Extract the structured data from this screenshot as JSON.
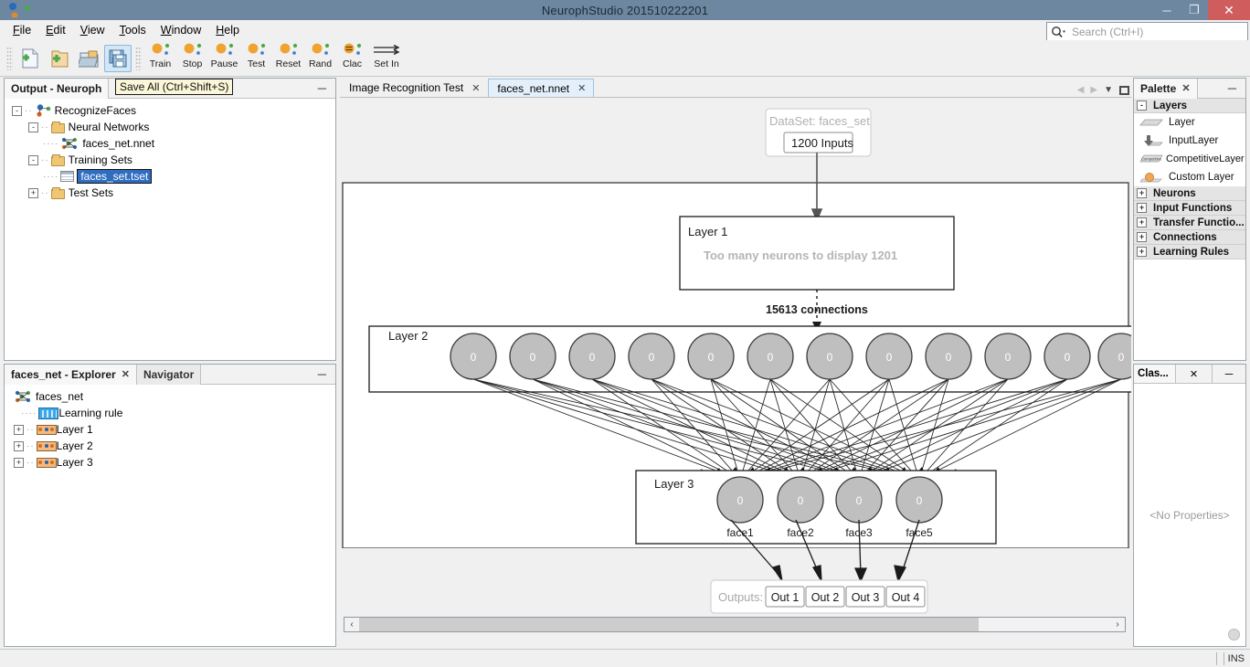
{
  "window": {
    "title": "NeurophStudio 201510222201",
    "minimize_label": "─",
    "maximize_label": "❐",
    "close_label": "✕"
  },
  "menubar": {
    "items": [
      {
        "label": "File",
        "accel": "F"
      },
      {
        "label": "Edit",
        "accel": "E"
      },
      {
        "label": "View",
        "accel": "V"
      },
      {
        "label": "Tools",
        "accel": "T"
      },
      {
        "label": "Window",
        "accel": "W"
      },
      {
        "label": "Help",
        "accel": "H"
      }
    ]
  },
  "search": {
    "placeholder": "Search (Ctrl+I)",
    "icon": "magnifier-icon"
  },
  "toolbar": {
    "file_buttons": [
      {
        "name": "new-file-button",
        "icon": "new-file-icon"
      },
      {
        "name": "new-project-button",
        "icon": "new-project-icon"
      },
      {
        "name": "open-project-button",
        "icon": "open-folder-icon"
      },
      {
        "name": "save-all-button",
        "icon": "save-all-icon",
        "selected": true
      }
    ],
    "actions": [
      {
        "label": "Train",
        "icon": "neuron-icon"
      },
      {
        "label": "Stop",
        "icon": "neuron-icon"
      },
      {
        "label": "Pause",
        "icon": "neuron-icon"
      },
      {
        "label": "Test",
        "icon": "neuron-icon"
      },
      {
        "label": "Reset",
        "icon": "neuron-icon"
      },
      {
        "label": "Rand",
        "icon": "neuron-icon"
      },
      {
        "label": "Clac",
        "icon": "neuron-calc-icon"
      },
      {
        "label": "Set In",
        "icon": "arrows-right-icon"
      }
    ]
  },
  "tooltip": {
    "save_all": "Save All (Ctrl+Shift+S)"
  },
  "output_panel": {
    "title": "Output - Neuroph",
    "minimize_label": "─",
    "tree": [
      {
        "label": "RecognizeFaces",
        "depth": 0,
        "toggle": "-",
        "icon": "project-icon",
        "selected": false
      },
      {
        "label": "Neural Networks",
        "depth": 1,
        "toggle": "-",
        "icon": "folder-icon",
        "selected": false
      },
      {
        "label": "faces_net.nnet",
        "depth": 2,
        "toggle": "",
        "icon": "network-icon",
        "selected": false
      },
      {
        "label": "Training Sets",
        "depth": 1,
        "toggle": "-",
        "icon": "folder-icon",
        "selected": false
      },
      {
        "label": "faces_set.tset",
        "depth": 2,
        "toggle": "",
        "icon": "table-icon",
        "selected": true
      },
      {
        "label": "Test Sets",
        "depth": 1,
        "toggle": "+",
        "icon": "folder-icon",
        "selected": false
      }
    ]
  },
  "explorer_panel": {
    "tabs": [
      {
        "label": "faces_net - Explorer",
        "active": true,
        "closable": true
      },
      {
        "label": "Navigator",
        "active": false,
        "closable": false
      }
    ],
    "minimize_label": "─",
    "tree": [
      {
        "label": "faces_net",
        "depth": 0,
        "toggle": "",
        "icon": "network-icon"
      },
      {
        "label": "Learning rule",
        "depth": 1,
        "toggle": "",
        "icon": "learning-rule-icon"
      },
      {
        "label": "Layer 1",
        "depth": 1,
        "toggle": "+",
        "icon": "layer-icon"
      },
      {
        "label": "Layer 2",
        "depth": 1,
        "toggle": "+",
        "icon": "layer-icon"
      },
      {
        "label": "Layer 3",
        "depth": 1,
        "toggle": "+",
        "icon": "layer-icon"
      }
    ]
  },
  "editor": {
    "tabs": [
      {
        "label": "Image Recognition Test",
        "active": false
      },
      {
        "label": "faces_net.nnet",
        "active": true
      }
    ],
    "nav": {
      "prev": "◀",
      "next": "▶",
      "dropdown": "▼",
      "maximize": "maximize-icon"
    },
    "scrollbar": {
      "left_arrow": "‹",
      "right_arrow": "›"
    }
  },
  "diagram": {
    "dataset": {
      "title": "DataSet: faces_set",
      "inputs_label": "1200 Inputs"
    },
    "layer1": {
      "title": "Layer 1",
      "note": "Too many neurons to display 1201"
    },
    "connections_label": "15613 connections",
    "layer2": {
      "title": "Layer 2",
      "neuron_value": "0",
      "visible_neurons": 13
    },
    "layer3": {
      "title": "Layer 3",
      "neuron_value": "0",
      "neuron_labels": [
        "face1",
        "face2",
        "face3",
        "face5"
      ]
    },
    "outputs": {
      "label": "Outputs:",
      "items": [
        "Out 1",
        "Out 2",
        "Out 3",
        "Out 4"
      ]
    }
  },
  "palette_panel": {
    "title": "Palette",
    "close_label": "✕",
    "minimize_label": "─",
    "groups": [
      {
        "label": "Layers",
        "toggle": "-",
        "expanded": true,
        "items": [
          {
            "label": "Layer",
            "icon": "layer-shape-icon"
          },
          {
            "label": "InputLayer",
            "icon": "input-layer-icon"
          },
          {
            "label": "CompetitiveLayer",
            "icon": "competitive-layer-icon"
          },
          {
            "label": "Custom Layer",
            "icon": "custom-layer-icon"
          }
        ]
      },
      {
        "label": "Neurons",
        "toggle": "+",
        "expanded": false,
        "items": []
      },
      {
        "label": "Input Functions",
        "toggle": "+",
        "expanded": false,
        "items": []
      },
      {
        "label": "Transfer Functio...",
        "toggle": "+",
        "expanded": false,
        "items": []
      },
      {
        "label": "Connections",
        "toggle": "+",
        "expanded": false,
        "items": []
      },
      {
        "label": "Learning Rules",
        "toggle": "+",
        "expanded": false,
        "items": []
      }
    ]
  },
  "properties_panel": {
    "title": "Clas...",
    "close_label": "✕",
    "minimize_label": "─",
    "empty_text": "<No Properties>"
  },
  "statusbar": {
    "insert_mode": "INS"
  },
  "colors": {
    "titlebar": "#6d87a0",
    "close_button": "#cf5d5d",
    "selection": "#2f6dc0",
    "panel_bg": "#f0f0f0",
    "neuron_fill": "#bfbfbf",
    "tooltip_bg": "#fbf6d8",
    "active_tab": "#e3f0fb"
  }
}
